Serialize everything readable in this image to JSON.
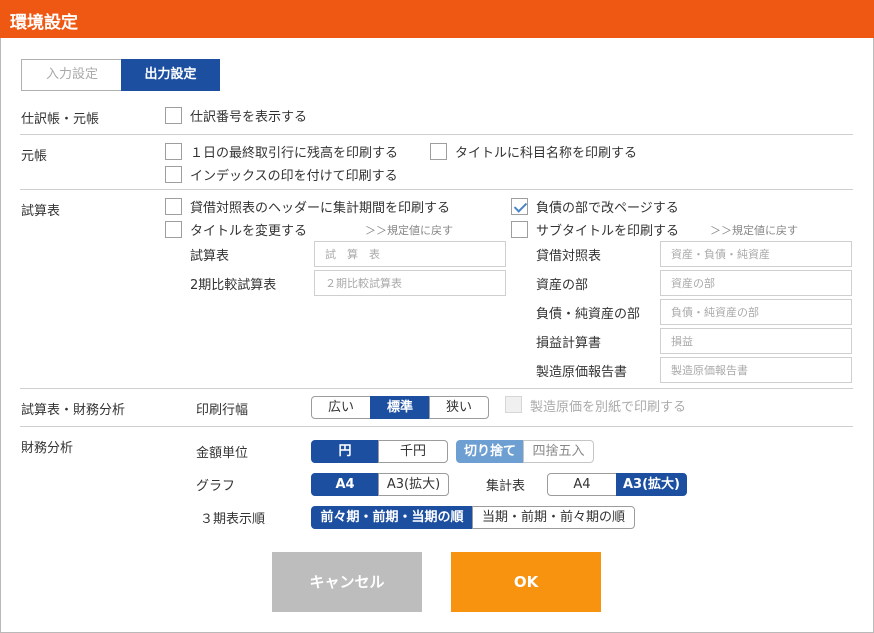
{
  "dialog": {
    "title": "環境設定"
  },
  "tabs": {
    "input": "入力設定",
    "output": "出力設定"
  },
  "journal": {
    "label": "仕訳帳・元帳",
    "show_number": "仕訳番号を表示する"
  },
  "ledger": {
    "label": "元帳",
    "print_balance": "１日の最終取引行に残高を印刷する",
    "print_account_title": "タイトルに科目名称を印刷する",
    "print_index": "インデックスの印を付けて印刷する"
  },
  "trial": {
    "label": "試算表",
    "print_header_period": "貸借対照表のヘッダーに集計期間を印刷する",
    "change_title": "タイトルを変更する",
    "reset_left": "＞＞規定値に戻す",
    "page_break_liability": "負債の部で改ページする",
    "print_subtitle": "サブタイトルを印刷する",
    "reset_right": "＞＞規定値に戻す",
    "fields_left": [
      {
        "label": "試算表",
        "placeholder": "試　算　表"
      },
      {
        "label": "2期比較試算表",
        "placeholder": "２期比較試算表"
      }
    ],
    "fields_right": [
      {
        "label": "貸借対照表",
        "placeholder": "資産・負債・純資産"
      },
      {
        "label": "資産の部",
        "placeholder": "資産の部"
      },
      {
        "label": "負債・純資産の部",
        "placeholder": "負債・純資産の部"
      },
      {
        "label": "損益計算書",
        "placeholder": "損益"
      },
      {
        "label": "製造原価報告書",
        "placeholder": "製造原価報告書"
      }
    ]
  },
  "trial_finance": {
    "label": "試算表・財務分析",
    "row_width_label": "印刷行幅",
    "row_width_options": [
      "広い",
      "標準",
      "狭い"
    ],
    "row_width_selected": "標準",
    "separate_mfg_cost": "製造原価を別紙で印刷する"
  },
  "finance": {
    "label": "財務分析",
    "amount_unit_label": "金額単位",
    "amount_unit_options": [
      "円",
      "千円"
    ],
    "amount_unit_selected": "円",
    "rounding_options": [
      "切り捨て",
      "四捨五入"
    ],
    "rounding_selected": "切り捨て",
    "graph_label": "グラフ",
    "graph_options": [
      "A4",
      "A3(拡大)"
    ],
    "graph_selected": "A4",
    "summary_label": "集計表",
    "summary_options": [
      "A4",
      "A3(拡大)"
    ],
    "summary_selected": "A3(拡大)",
    "period_order_label": "３期表示順",
    "period_order_options": [
      "前々期・前期・当期の順",
      "当期・前期・前々期の順"
    ],
    "period_order_selected": "前々期・前期・当期の順"
  },
  "buttons": {
    "cancel": "キャンセル",
    "ok": "OK"
  },
  "colors": {
    "titlebar": "#ee5812",
    "primary": "#1d4fa1",
    "ok": "#f7930f",
    "cancel": "#bdbdbd"
  }
}
